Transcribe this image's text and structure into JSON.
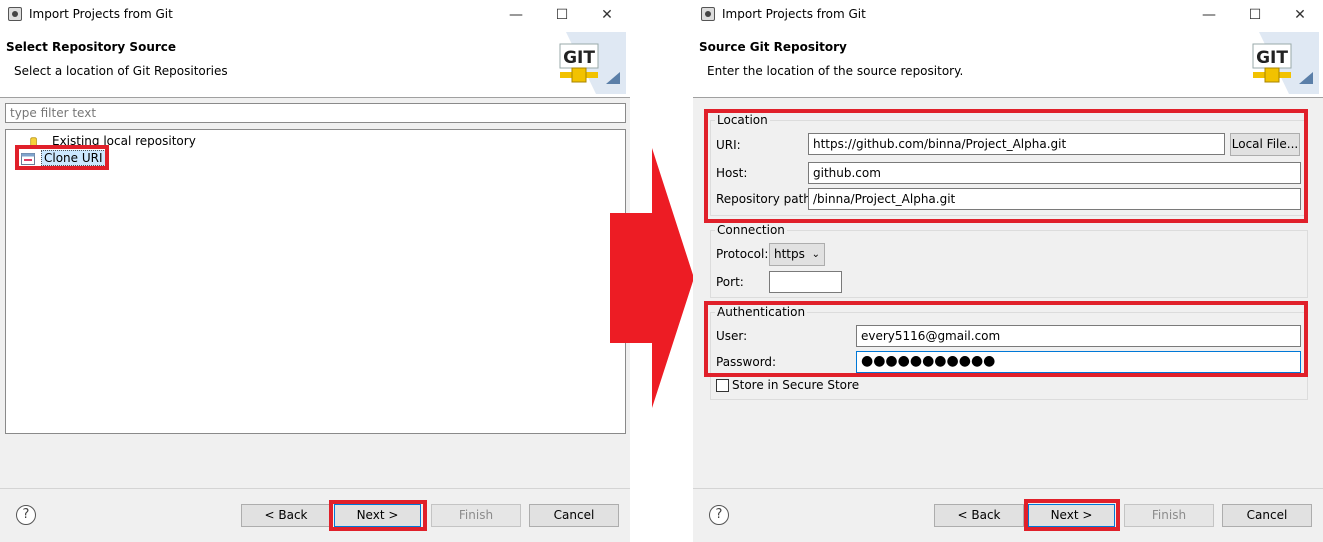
{
  "left_window": {
    "title": "Import Projects from Git",
    "header_title": "Select Repository Source",
    "header_desc": "Select a location of Git Repositories",
    "filter_placeholder": "type filter text",
    "tree_items": [
      {
        "label": "Existing local repository",
        "icon": "repository-icon"
      },
      {
        "label": "Clone URI",
        "icon": "clone-uri-icon",
        "selected": true
      }
    ],
    "buttons": {
      "back": "< Back",
      "next": "Next >",
      "finish": "Finish",
      "cancel": "Cancel"
    },
    "help": "?"
  },
  "right_window": {
    "title": "Import Projects from Git",
    "header_title": "Source Git Repository",
    "header_desc": "Enter the location of the source repository.",
    "location": {
      "legend": "Location",
      "uri_label": "URI:",
      "uri_value": "https://github.com/binna/Project_Alpha.git",
      "local_file_button": "Local File...",
      "host_label": "Host:",
      "host_value": "github.com",
      "repo_path_label": "Repository path:",
      "repo_path_value": "/binna/Project_Alpha.git"
    },
    "connection": {
      "legend": "Connection",
      "protocol_label": "Protocol:",
      "protocol_value": "https",
      "port_label": "Port:",
      "port_value": ""
    },
    "authentication": {
      "legend": "Authentication",
      "user_label": "User:",
      "user_value": "every5116@gmail.com",
      "password_label": "Password:",
      "password_value": "●●●●●●●●●●●",
      "store_label": "Store in Secure Store",
      "store_checked": false
    },
    "buttons": {
      "back": "< Back",
      "next": "Next >",
      "finish": "Finish",
      "cancel": "Cancel"
    },
    "help": "?"
  },
  "logo_text": "GIT",
  "colors": {
    "highlight": "#e0202a",
    "arrow": "#ed1c24",
    "selection": "#cce8ff"
  },
  "window_controls": {
    "minimize": "—",
    "maximize": "☐",
    "close": "✕"
  }
}
